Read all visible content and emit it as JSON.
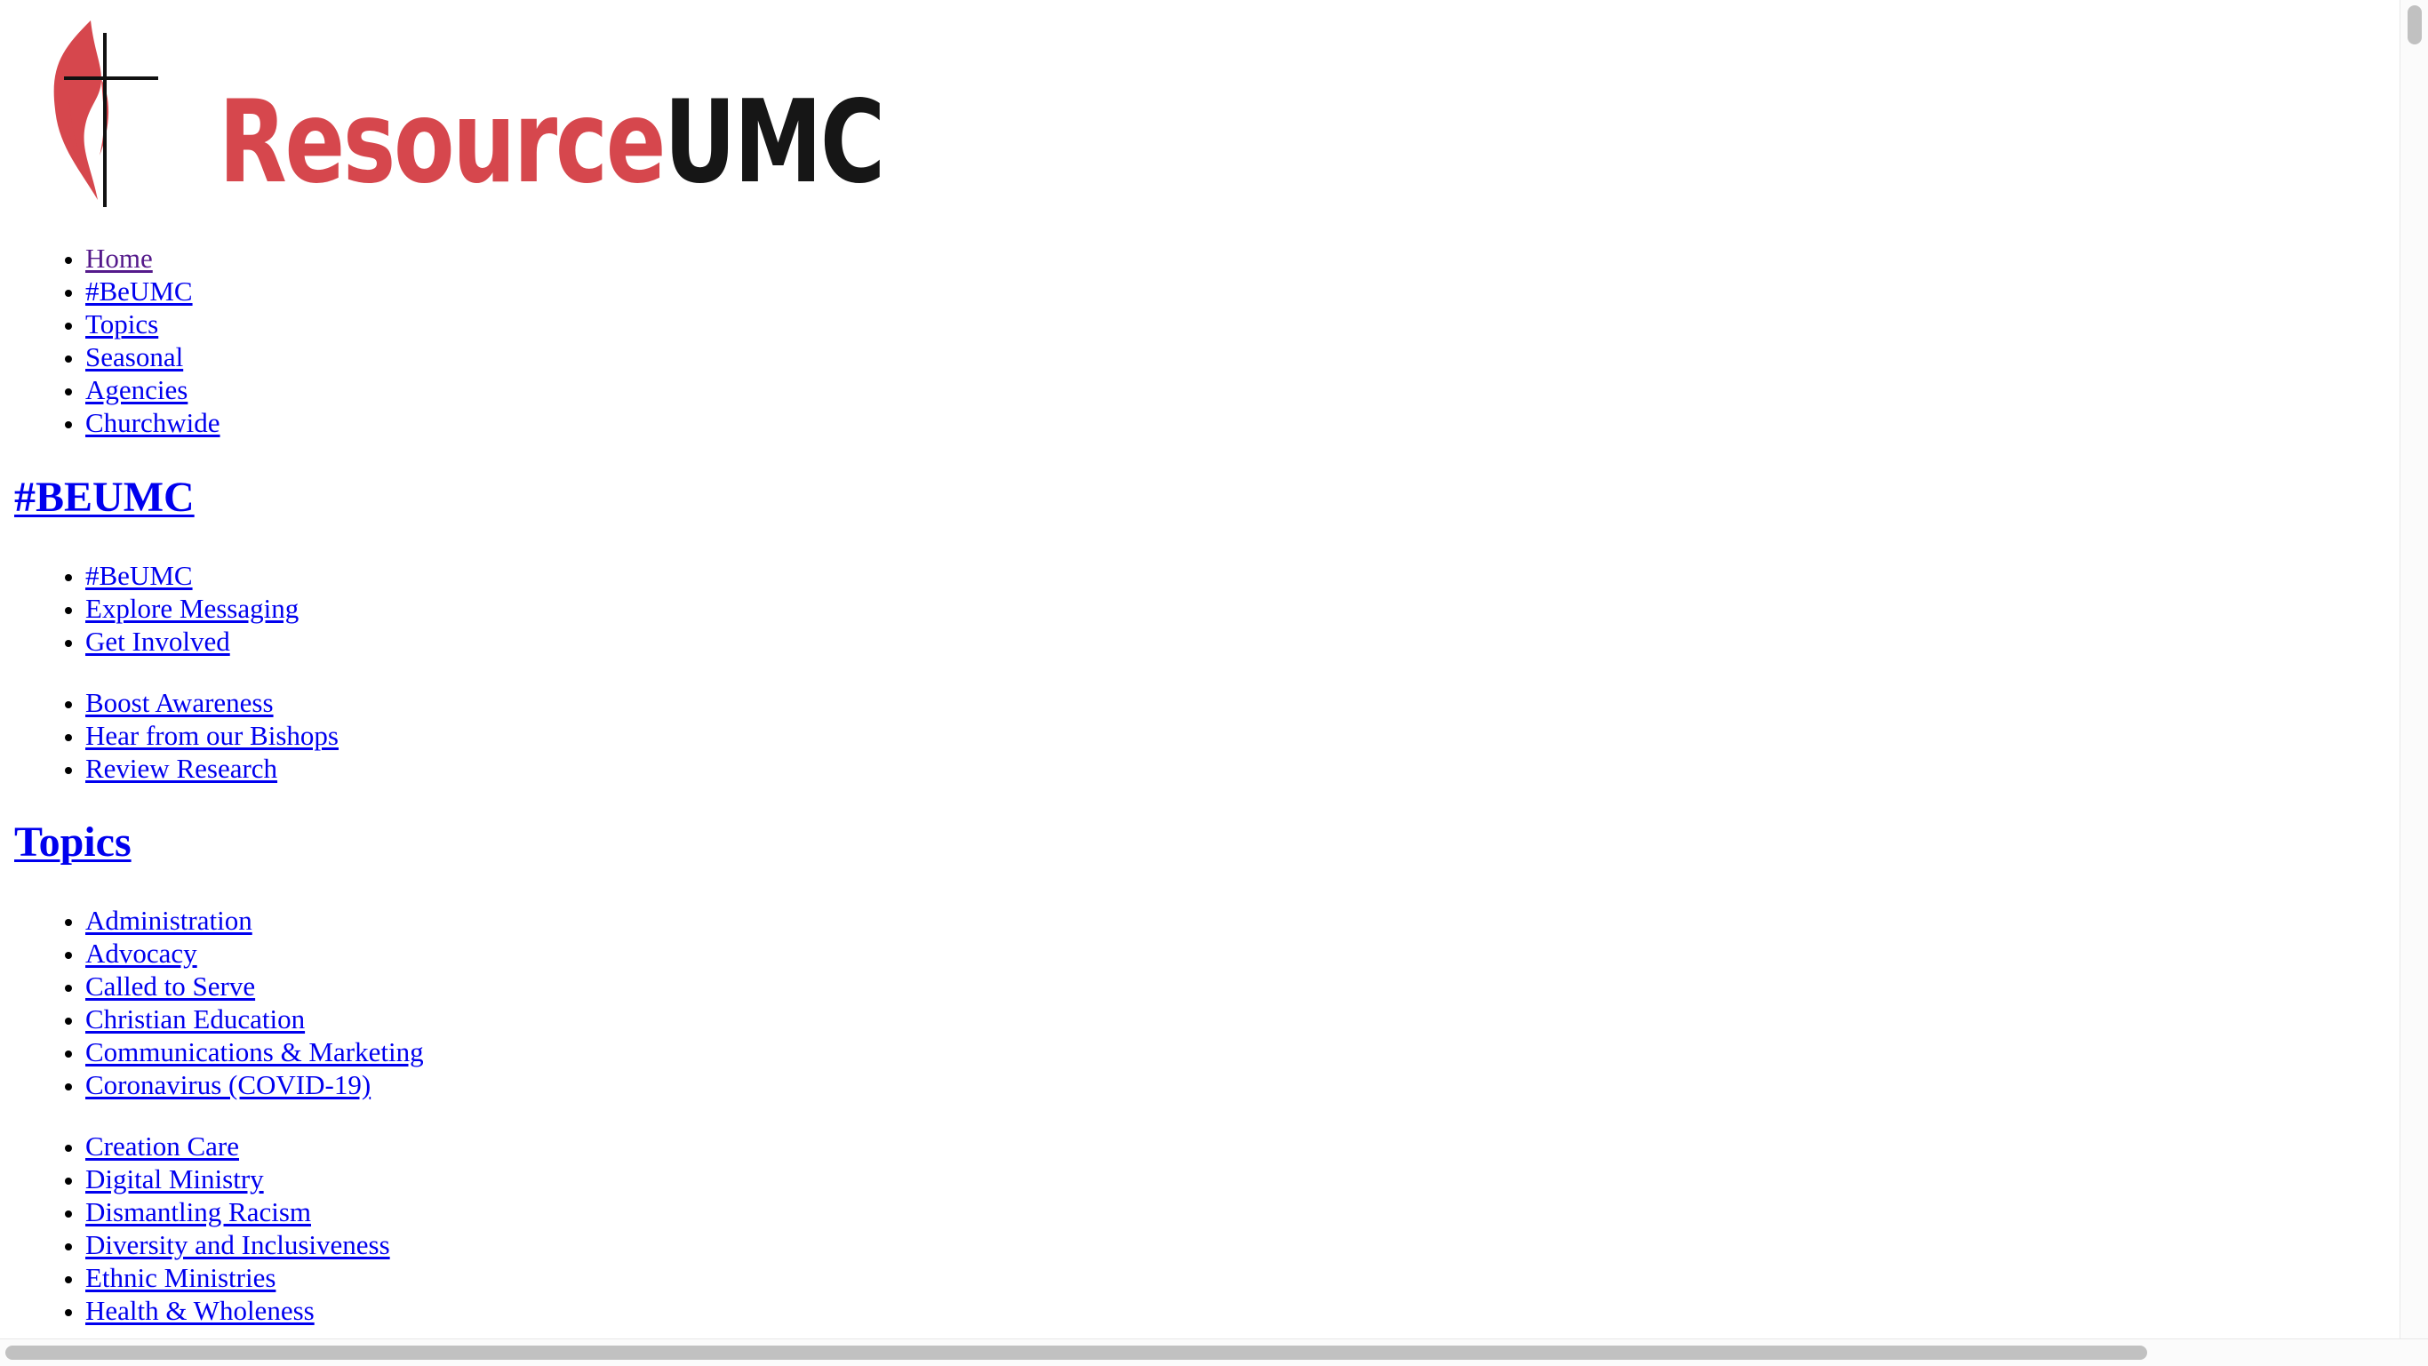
{
  "logo": {
    "text_red": "Resource",
    "text_black": "UMC",
    "colors": {
      "red": "#d6474d",
      "black": "#161616"
    }
  },
  "main_nav": [
    {
      "label": "Home",
      "visited": true
    },
    {
      "label": "#BeUMC"
    },
    {
      "label": "Topics"
    },
    {
      "label": "Seasonal"
    },
    {
      "label": "Agencies"
    },
    {
      "label": "Churchwide"
    }
  ],
  "sections": [
    {
      "heading": "#BEUMC",
      "groups": [
        [
          "#BeUMC",
          "Explore Messaging",
          "Get Involved"
        ],
        [
          "Boost Awareness",
          "Hear from our Bishops",
          "Review Research"
        ]
      ]
    },
    {
      "heading": "Topics",
      "groups": [
        [
          "Administration",
          "Advocacy",
          "Called to Serve",
          "Christian Education",
          "Communications & Marketing",
          "Coronavirus (COVID-19)"
        ],
        [
          "Creation Care",
          "Digital Ministry",
          "Dismantling Racism",
          "Diversity and Inclusiveness",
          "Ethnic Ministries",
          "Health & Wholeness"
        ]
      ]
    }
  ],
  "colors": {
    "link": "#0000ee",
    "visited_link": "#551a8b",
    "scrollbar_thumb": "#c1c1c1"
  }
}
